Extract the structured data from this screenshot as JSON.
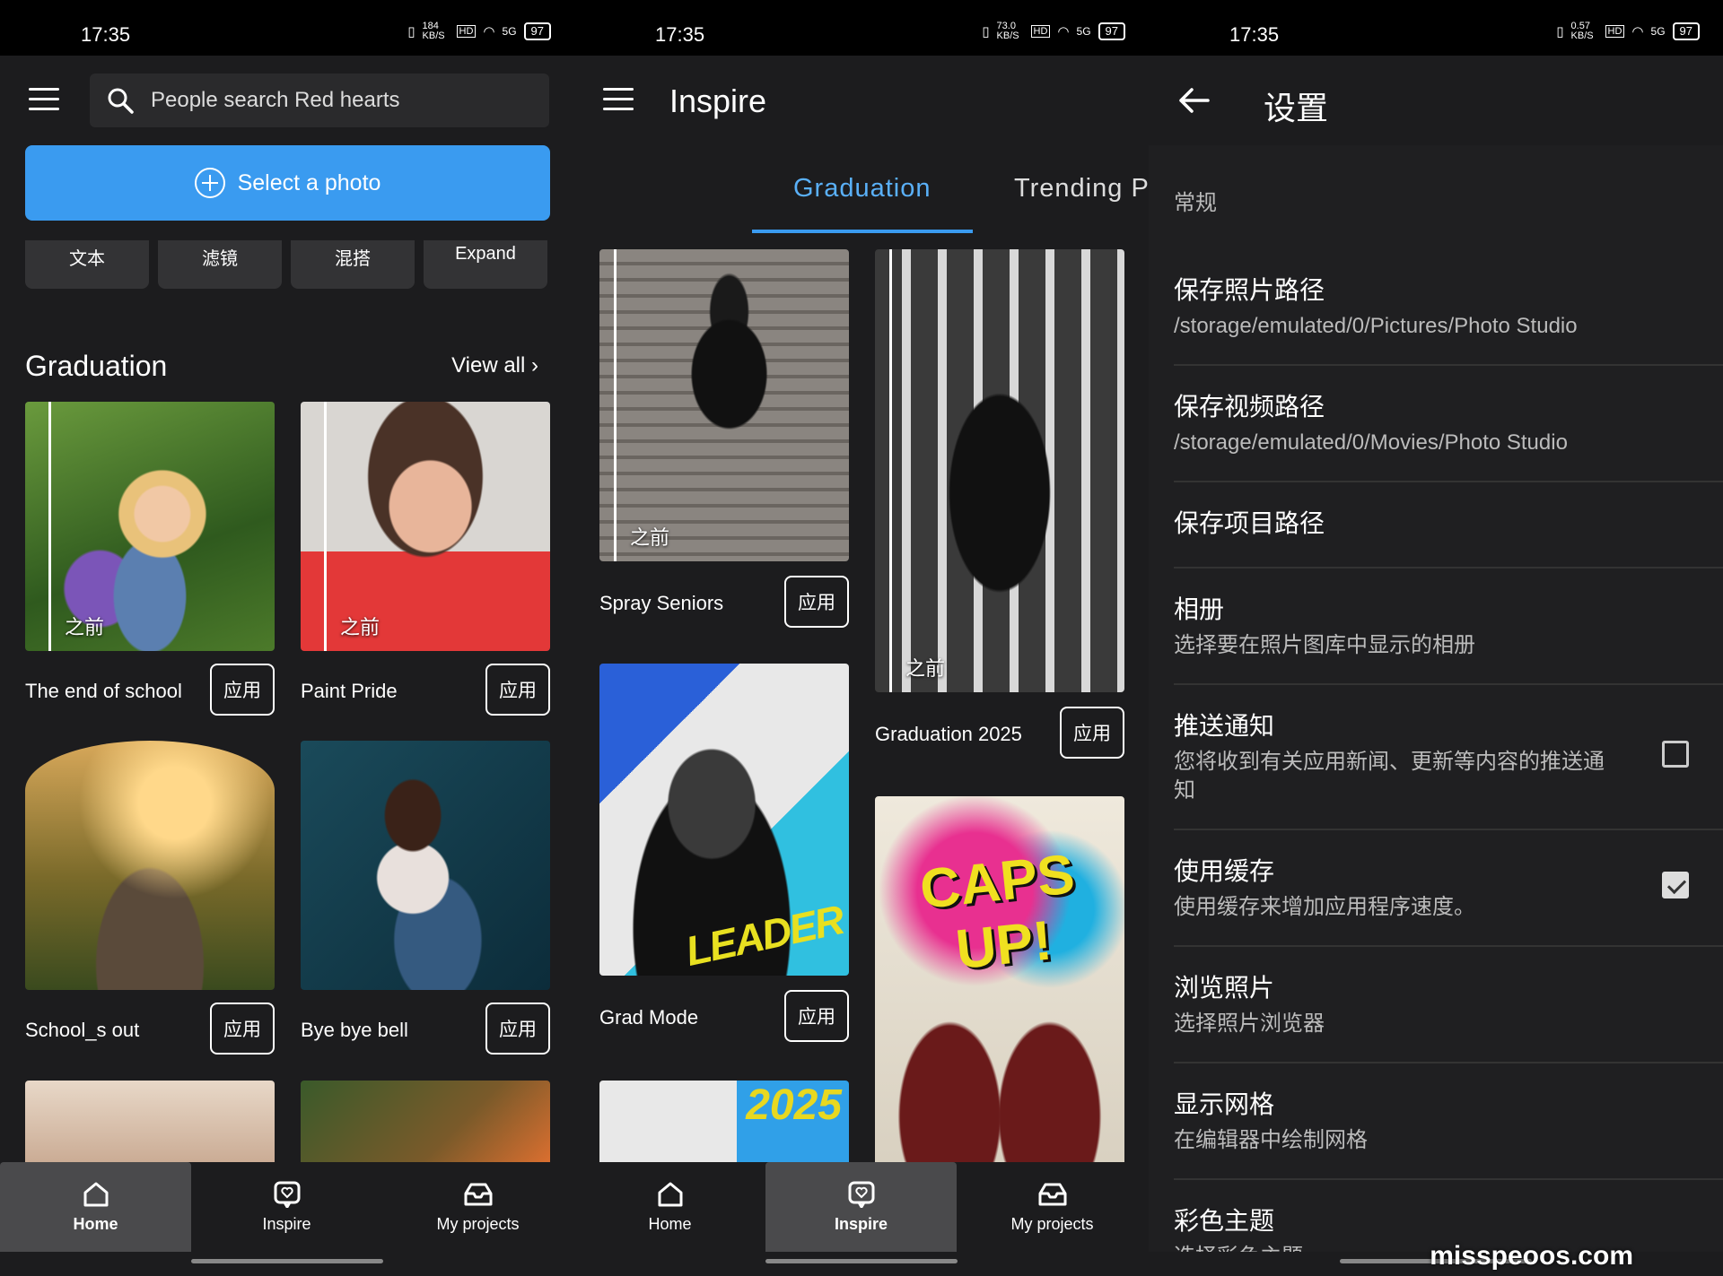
{
  "status": {
    "time": "17:35",
    "battery": "97",
    "speeds": [
      "184 KB/S",
      "73.0 KB/S",
      "0.57 KB/S"
    ],
    "network": "5G",
    "hd": "HD"
  },
  "home": {
    "search_placeholder": "People search Red hearts",
    "select_photo": "Select a photo",
    "tools": [
      "文本",
      "滤镜",
      "混搭",
      "Expand"
    ],
    "section_title": "Graduation",
    "view_all": "View all",
    "before_label": "之前",
    "apply_label": "应用",
    "cards": [
      {
        "title": "The end of school"
      },
      {
        "title": "Paint Pride"
      },
      {
        "title": "School_s out"
      },
      {
        "title": "Bye bye bell"
      }
    ]
  },
  "inspire": {
    "title": "Inspire",
    "tabs": [
      "Graduation",
      "Trending P"
    ],
    "cards": [
      {
        "title": "Spray Seniors"
      },
      {
        "title": "Graduation 2025"
      },
      {
        "title": "Grad Mode"
      }
    ],
    "poster_text": [
      "CAPS",
      "UP!"
    ],
    "leader_text": "LEADER",
    "year_text": "2025"
  },
  "nav": {
    "items": [
      "Home",
      "Inspire",
      "My projects"
    ]
  },
  "settings": {
    "title": "设置",
    "category": "常规",
    "items": [
      {
        "title": "保存照片路径",
        "sub": "/storage/emulated/0/Pictures/Photo Studio"
      },
      {
        "title": "保存视频路径",
        "sub": "/storage/emulated/0/Movies/Photo Studio"
      },
      {
        "title": "保存项目路径",
        "sub": ""
      },
      {
        "title": "相册",
        "sub": "选择要在照片图库中显示的相册"
      },
      {
        "title": "推送通知",
        "sub": "您将收到有关应用新闻、更新等内容的推送通知",
        "checked": false
      },
      {
        "title": "使用缓存",
        "sub": "使用缓存来增加应用程序速度。",
        "checked": true
      },
      {
        "title": "浏览照片",
        "sub": "选择照片浏览器"
      },
      {
        "title": "显示网格",
        "sub": "在编辑器中绘制网格"
      },
      {
        "title": "彩色主题",
        "sub": "选择彩色主题"
      }
    ]
  },
  "watermark": "misspeoos.com"
}
